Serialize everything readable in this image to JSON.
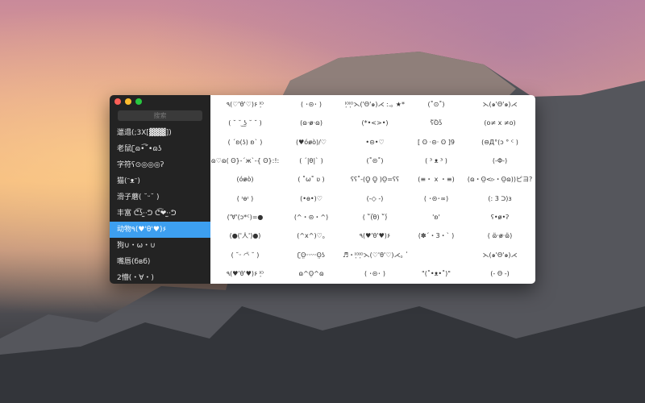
{
  "search": {
    "placeholder": "搜索"
  },
  "sidebar": {
    "items": [
      {
        "label": "邋遢(;3X[▓▓▓])"
      },
      {
        "label": "老鼠ʗɷ•͡˘•ɷʖ"
      },
      {
        "label": "字符ʕ⊙◎◎◎ʔ"
      },
      {
        "label": "猫(ᵔᴥᵔ)"
      },
      {
        "label": "滑子蘑( ˘ᵕ˘ )"
      },
      {
        "label": "丰富 ᕦ͡ʖ·̫·ᕤ ᕦ͡❤·̫·ᕤ"
      },
      {
        "label": "动物٩(♥'θ'♥)۶"
      },
      {
        "label": "狗∪・ω・∪"
      },
      {
        "label": "嘴唇(бвб)"
      },
      {
        "label": "2懵(・∀・)"
      }
    ],
    "selected_index": 6
  },
  "grid": [
    [
      "٩(♡'θ'♡)۶ ˡ͙ᴼ",
      "( ･⊝･ )",
      "ˡ͙ᴼˡ͙ᴼ⋋('Θ'๑)⋌ :.｡ ★*",
      "(˚⊙˚)",
      "⋋(๑'Θ'๑)⋌"
    ],
    [
      "( ˘ ˘ ͜ʖ ˘ ˘ )",
      "(ɷ·ɵ̷·ɷ)",
      "(*•<>•)",
      "ʕ͡ʘʖ͡",
      "(o≠ x ≠o)"
    ],
    [
      "( ´ʚ(ʖ) ʚ` )",
      "(♥óɵ̷ò)/♡",
      "•⊝•♡",
      "[ ʘ ·⊝· ʘ ]9",
      "(⊖Д°(ↄ ° ᑦ )"
    ],
    [
      "ɷ♡ɷ( ʘ}‐´ж`‐{ ʘ}:!:",
      "( ´|θ|` )",
      "(˚⊝˚)",
      "( ³ ᴥ ³ )",
      "(-Φ-)"
    ],
    [
      "(óɵ̷ò)",
      "( ˚ω˚ ʋ )",
      "ʕʕ˚-(ʘ̤̮ ʘ̤̮ )ʘ̤=ʕʕ",
      "(≡・ x ・≡)",
      "(ɷ・ʘ̤<▹・ʘ̤ɷ))ピヨ?"
    ],
    [
      "( ᶦɵᶦ )",
      "(•ɵ•)♡",
      "(-◇ -)",
      "( ･⊝･∞)",
      "(: 3 ᑐ)ɜ"
    ],
    [
      "('∀'(ↄ*ᑦ)=●",
      "(^・⊝・^)",
      "( ˘͡(θ) ˘͡)",
      "'ʚ'",
      "ʕ•ɵ̷•ʔ"
    ],
    [
      "(●('人')●)",
      "(^x^)♡｡",
      "٩(♥'θ'♥)۶",
      "(✽´・3・` )",
      "( ɷ̈·ɵ̷·ɷ̈)"
    ],
    [
      "( ˘ᵕ ◠̈ ˘ )",
      "ʗʘ̤ᵕᵕᵕᵕʘ̤ʖ",
      "♬・ˡ͙ᴼˡ͙ᴼ⋋(♡'θ'♡)⋌｡ ˚ ˡ͙ᴼ⋯",
      "",
      "⋋(๑'Θ'๑)⋌"
    ],
    [
      "٩(♥'θ'♥)۶ ˡ͙ᴼ",
      "ɷ^ʘ̤^ɷ",
      "( ･⊝･ )",
      "\"(˚•ᴥ•˚)\"",
      "(- Θ -)"
    ]
  ]
}
